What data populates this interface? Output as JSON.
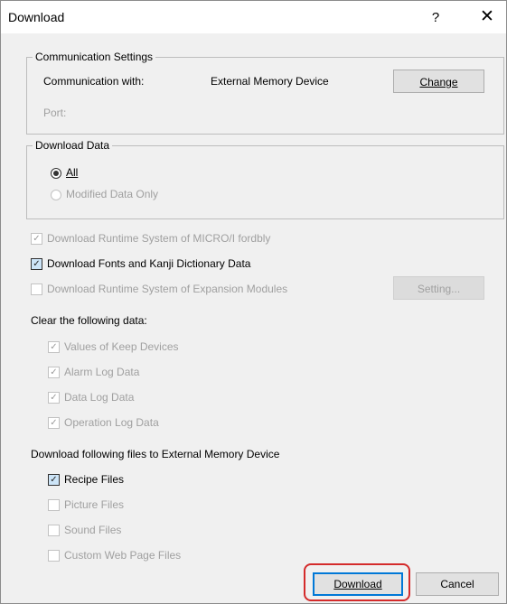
{
  "window": {
    "title": "Download",
    "help": "?",
    "close": "✕"
  },
  "communication": {
    "legend": "Communication Settings",
    "with_label": "Communication with:",
    "with_value": "External Memory Device",
    "change_button": "Change",
    "port_label": "Port:"
  },
  "download_data": {
    "legend": "Download Data",
    "all_label": "All",
    "modified_label": "Modified Data Only"
  },
  "options": {
    "runtime_micro": "Download Runtime System of MICRO/I fordbly",
    "fonts_kanji": "Download Fonts and Kanji Dictionary Data",
    "runtime_expansion": "Download Runtime System of Expansion Modules",
    "setting_button": "Setting..."
  },
  "clear_data": {
    "heading": "Clear the following data:",
    "items": [
      "Values of Keep Devices",
      "Alarm Log Data",
      "Data Log Data",
      "Operation Log Data"
    ]
  },
  "external_memory": {
    "heading": "Download following files to External Memory Device",
    "items": [
      "Recipe Files",
      "Picture Files",
      "Sound Files",
      "Custom Web Page Files"
    ]
  },
  "footer": {
    "download_button": "Download",
    "cancel_button": "Cancel"
  },
  "marks": {
    "check": "✓"
  }
}
